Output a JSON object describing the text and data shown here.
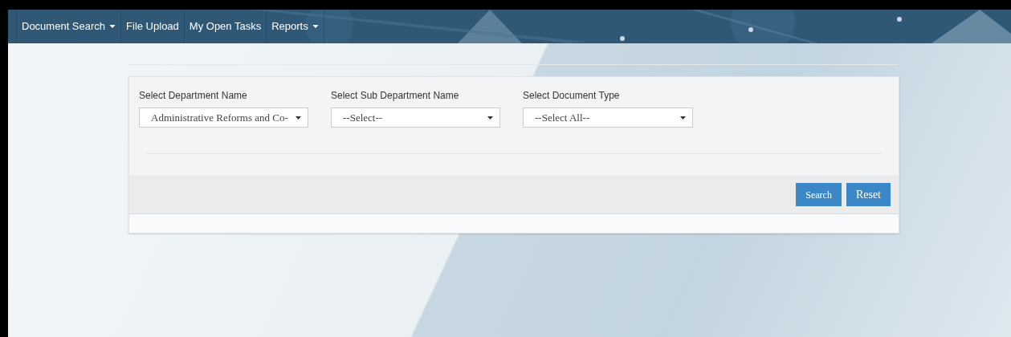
{
  "navbar": {
    "items": [
      {
        "label": "Document Search",
        "dropdown": true
      },
      {
        "label": "File Upload",
        "dropdown": false
      },
      {
        "label": "My Open Tasks",
        "dropdown": false
      },
      {
        "label": "Reports",
        "dropdown": true
      }
    ]
  },
  "filters": [
    {
      "label": "Select Department Name",
      "value": "Administrative Reforms and Co-"
    },
    {
      "label": "Select Sub Department Name",
      "value": "--Select--"
    },
    {
      "label": "Select Document Type",
      "value": "--Select All--"
    }
  ],
  "buttons": [
    "Search",
    "Reset"
  ]
}
